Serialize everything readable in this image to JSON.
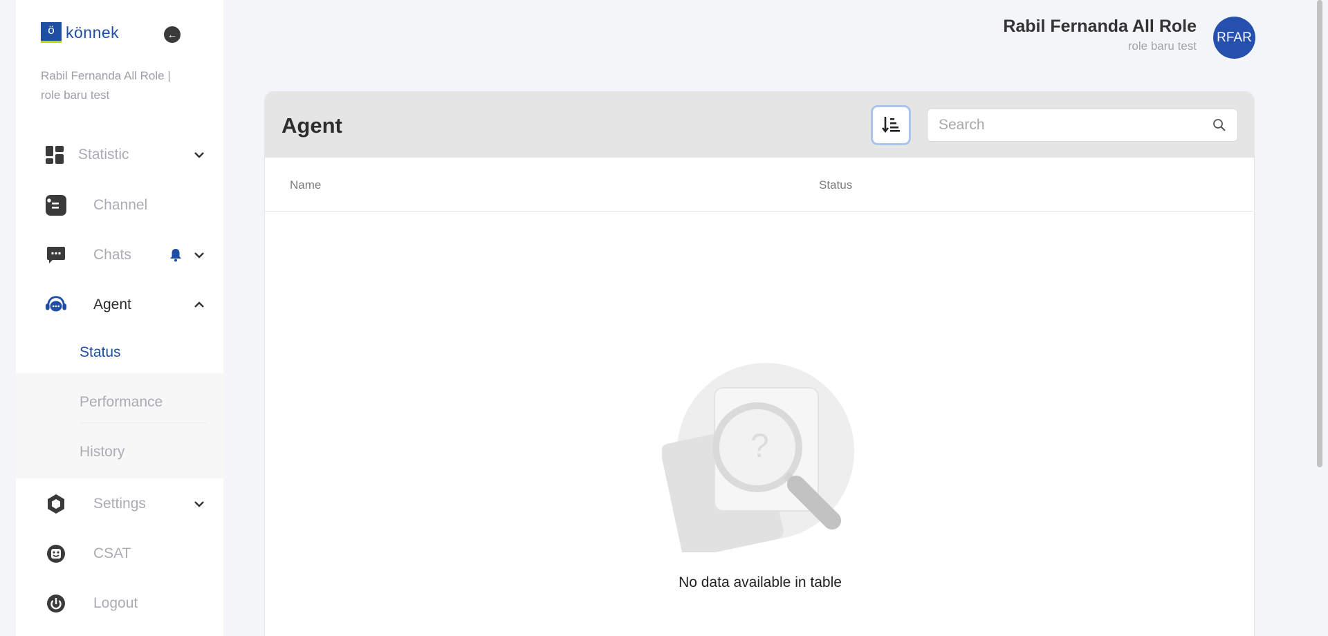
{
  "brand": {
    "logo_mark": "ö",
    "logo_text": "könnek"
  },
  "sidebar": {
    "user_line": "Rabil Fernanda All Role | role baru test",
    "items": [
      {
        "label": "Statistic",
        "icon": "dashboard-icon"
      },
      {
        "label": "Channel",
        "icon": "channel-icon"
      },
      {
        "label": "Chats",
        "icon": "chat-icon"
      },
      {
        "label": "Agent",
        "icon": "headset-icon"
      },
      {
        "label": "Settings",
        "icon": "hexagon-settings-icon"
      },
      {
        "label": "CSAT",
        "icon": "smiley-icon"
      },
      {
        "label": "Logout",
        "icon": "power-icon"
      }
    ],
    "agent_sub": [
      {
        "label": "Status"
      },
      {
        "label": "Performance"
      },
      {
        "label": "History"
      }
    ]
  },
  "header": {
    "user_name": "Rabil Fernanda All Role",
    "user_role": "role baru test",
    "avatar_initials": "RFAR"
  },
  "main": {
    "title": "Agent",
    "search_placeholder": "Search",
    "columns": [
      "Name",
      "Status"
    ],
    "empty_message": "No data available in table"
  },
  "colors": {
    "brand": "#1f4fa3",
    "accent": "#c8d400",
    "avatar": "#2550ad"
  }
}
